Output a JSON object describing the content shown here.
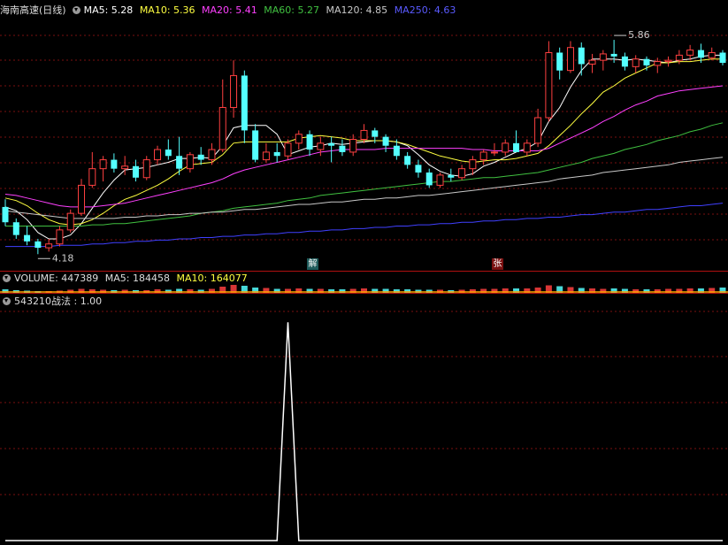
{
  "header_main": {
    "title": "海南高速(日线)",
    "ma5": "MA5: 5.28",
    "ma10": "MA10: 5.36",
    "ma20": "MA20: 5.41",
    "ma60": "MA60: 5.27",
    "ma120": "MA120: 4.85",
    "ma250": "MA250: 4.63"
  },
  "header_volume": {
    "volume": "VOLUME: 447389",
    "ma5": "MA5: 184458",
    "ma10": "MA10: 164077"
  },
  "header_indicator": {
    "label": "543210战法 : 1.00"
  },
  "markers": {
    "jie": "解",
    "zhang": "张"
  },
  "colors": {
    "up": "#ff4040",
    "down": "#54ffff",
    "ma5": "#ffffff",
    "ma10": "#ffff40",
    "ma20": "#ff40ff",
    "ma60": "#40c040",
    "ma120": "#c8c8c8",
    "ma250": "#4040ff",
    "grid": "#7a1010",
    "volume": "#ffa500"
  },
  "chart_data": [
    {
      "type": "candlestick",
      "title": "海南高速(日线)",
      "ylim": [
        4.05,
        6.02
      ],
      "annotations": [
        {
          "text": "4.18",
          "price": 4.18,
          "index": 3
        },
        {
          "text": "5.86",
          "price": 5.86,
          "index": 56
        }
      ],
      "candles": [
        [
          4.55,
          4.61,
          4.4,
          4.43
        ],
        [
          4.43,
          4.46,
          4.3,
          4.33
        ],
        [
          4.33,
          4.4,
          4.25,
          4.28
        ],
        [
          4.28,
          4.3,
          4.18,
          4.23
        ],
        [
          4.23,
          4.3,
          4.2,
          4.26
        ],
        [
          4.26,
          4.4,
          4.24,
          4.37
        ],
        [
          4.37,
          4.53,
          4.35,
          4.5
        ],
        [
          4.5,
          4.77,
          4.48,
          4.72
        ],
        [
          4.72,
          4.98,
          4.7,
          4.85
        ],
        [
          4.85,
          4.95,
          4.75,
          4.92
        ],
        [
          4.92,
          4.97,
          4.82,
          4.85
        ],
        [
          4.85,
          4.95,
          4.8,
          4.87
        ],
        [
          4.87,
          4.92,
          4.75,
          4.78
        ],
        [
          4.78,
          4.95,
          4.76,
          4.92
        ],
        [
          4.92,
          5.03,
          4.88,
          5.0
        ],
        [
          5.0,
          5.08,
          4.92,
          4.95
        ],
        [
          4.95,
          5.1,
          4.8,
          4.85
        ],
        [
          4.85,
          4.98,
          4.82,
          4.96
        ],
        [
          4.96,
          5.02,
          4.88,
          4.92
        ],
        [
          4.92,
          5.05,
          4.88,
          5.0
        ],
        [
          5.0,
          5.55,
          4.98,
          5.33
        ],
        [
          5.33,
          5.7,
          5.25,
          5.58
        ],
        [
          5.58,
          5.62,
          5.05,
          5.15
        ],
        [
          5.15,
          5.2,
          4.9,
          4.92
        ],
        [
          4.92,
          5.05,
          4.9,
          4.98
        ],
        [
          4.98,
          5.05,
          4.9,
          4.95
        ],
        [
          4.95,
          5.08,
          4.92,
          5.05
        ],
        [
          5.05,
          5.15,
          5.0,
          5.12
        ],
        [
          5.12,
          5.15,
          4.95,
          5.0
        ],
        [
          5.0,
          5.1,
          4.95,
          5.05
        ],
        [
          5.05,
          5.1,
          4.9,
          5.03
        ],
        [
          5.03,
          5.08,
          4.95,
          4.98
        ],
        [
          4.98,
          5.12,
          4.95,
          5.08
        ],
        [
          5.08,
          5.2,
          5.05,
          5.15
        ],
        [
          5.15,
          5.17,
          5.05,
          5.1
        ],
        [
          5.1,
          5.12,
          4.98,
          5.03
        ],
        [
          5.03,
          5.08,
          4.92,
          4.95
        ],
        [
          4.95,
          4.98,
          4.85,
          4.88
        ],
        [
          4.88,
          4.92,
          4.78,
          4.82
        ],
        [
          4.82,
          4.85,
          4.7,
          4.72
        ],
        [
          4.72,
          4.82,
          4.7,
          4.8
        ],
        [
          4.8,
          4.85,
          4.75,
          4.78
        ],
        [
          4.78,
          4.88,
          4.76,
          4.85
        ],
        [
          4.85,
          4.95,
          4.8,
          4.92
        ],
        [
          4.92,
          5.0,
          4.88,
          4.98
        ],
        [
          4.98,
          5.05,
          4.95,
          4.98
        ],
        [
          4.98,
          5.08,
          4.95,
          5.05
        ],
        [
          5.05,
          5.15,
          5.0,
          4.98
        ],
        [
          4.98,
          5.08,
          4.95,
          5.05
        ],
        [
          5.05,
          5.32,
          5.02,
          5.25
        ],
        [
          5.25,
          5.85,
          5.22,
          5.76
        ],
        [
          5.76,
          5.8,
          5.55,
          5.62
        ],
        [
          5.62,
          5.85,
          5.6,
          5.8
        ],
        [
          5.8,
          5.84,
          5.58,
          5.67
        ],
        [
          5.67,
          5.75,
          5.6,
          5.7
        ],
        [
          5.7,
          5.78,
          5.62,
          5.75
        ],
        [
          5.75,
          5.86,
          5.68,
          5.73
        ],
        [
          5.73,
          5.76,
          5.62,
          5.65
        ],
        [
          5.65,
          5.74,
          5.6,
          5.71
        ],
        [
          5.71,
          5.73,
          5.62,
          5.66
        ],
        [
          5.66,
          5.72,
          5.6,
          5.69
        ],
        [
          5.69,
          5.73,
          5.65,
          5.7
        ],
        [
          5.7,
          5.78,
          5.67,
          5.74
        ],
        [
          5.74,
          5.82,
          5.7,
          5.78
        ],
        [
          5.78,
          5.83,
          5.68,
          5.72
        ],
        [
          5.72,
          5.8,
          5.7,
          5.76
        ],
        [
          5.76,
          5.78,
          5.66,
          5.68
        ]
      ],
      "series": [
        {
          "name": "MA5",
          "values": [
            4.55,
            4.52,
            4.45,
            4.35,
            4.3,
            4.3,
            4.33,
            4.42,
            4.54,
            4.66,
            4.76,
            4.84,
            4.85,
            4.86,
            4.88,
            4.9,
            4.93,
            4.93,
            4.94,
            4.93,
            5.03,
            5.17,
            5.19,
            5.19,
            5.19,
            5.12,
            4.96,
            4.99,
            5.02,
            5.03,
            5.05,
            5.04,
            5.05,
            5.06,
            5.07,
            5.07,
            5.06,
            5.03,
            4.96,
            4.88,
            4.83,
            4.8,
            4.79,
            4.81,
            4.87,
            4.9,
            4.94,
            4.98,
            5.01,
            5.06,
            5.22,
            5.33,
            5.49,
            5.62,
            5.71,
            5.71,
            5.71,
            5.7,
            5.71,
            5.7,
            5.69,
            5.68,
            5.7,
            5.71,
            5.73,
            5.74,
            5.74
          ]
        },
        {
          "name": "MA10",
          "values": [
            4.62,
            4.6,
            4.56,
            4.5,
            4.45,
            4.42,
            4.41,
            4.42,
            4.45,
            4.5,
            4.56,
            4.61,
            4.64,
            4.68,
            4.72,
            4.77,
            4.83,
            4.88,
            4.89,
            4.9,
            4.96,
            5.05,
            5.06,
            5.06,
            5.06,
            5.06,
            5.06,
            5.09,
            5.1,
            5.11,
            5.1,
            5.09,
            5.07,
            5.07,
            5.07,
            5.07,
            5.06,
            5.04,
            5.01,
            4.98,
            4.95,
            4.93,
            4.91,
            4.9,
            4.91,
            4.92,
            4.92,
            4.93,
            4.95,
            4.97,
            5.03,
            5.11,
            5.19,
            5.28,
            5.36,
            5.45,
            5.5,
            5.56,
            5.6,
            5.64,
            5.68,
            5.68,
            5.69,
            5.69,
            5.7,
            5.71,
            5.71
          ]
        },
        {
          "name": "MA20",
          "values": [
            4.65,
            4.64,
            4.62,
            4.6,
            4.58,
            4.56,
            4.55,
            4.55,
            4.55,
            4.56,
            4.57,
            4.58,
            4.6,
            4.62,
            4.64,
            4.66,
            4.68,
            4.7,
            4.72,
            4.74,
            4.77,
            4.81,
            4.84,
            4.86,
            4.88,
            4.9,
            4.92,
            4.94,
            4.96,
            4.98,
            4.99,
            5.0,
            5.0,
            5.0,
            5.0,
            5.01,
            5.01,
            5.01,
            5.01,
            5.01,
            5.01,
            5.01,
            5.01,
            5.0,
            5.0,
            4.99,
            4.99,
            4.99,
            4.99,
            4.99,
            5.01,
            5.05,
            5.09,
            5.13,
            5.17,
            5.22,
            5.26,
            5.31,
            5.35,
            5.38,
            5.42,
            5.44,
            5.46,
            5.47,
            5.48,
            5.49,
            5.5
          ]
        },
        {
          "name": "MA60",
          "values": [
            4.4,
            4.4,
            4.4,
            4.4,
            4.4,
            4.4,
            4.4,
            4.4,
            4.41,
            4.41,
            4.42,
            4.42,
            4.43,
            4.44,
            4.45,
            4.46,
            4.47,
            4.48,
            4.5,
            4.51,
            4.52,
            4.54,
            4.55,
            4.56,
            4.57,
            4.58,
            4.6,
            4.61,
            4.62,
            4.64,
            4.65,
            4.66,
            4.67,
            4.68,
            4.69,
            4.7,
            4.71,
            4.72,
            4.73,
            4.74,
            4.75,
            4.75,
            4.76,
            4.77,
            4.78,
            4.78,
            4.79,
            4.8,
            4.81,
            4.82,
            4.84,
            4.86,
            4.88,
            4.9,
            4.93,
            4.95,
            4.97,
            5.0,
            5.02,
            5.04,
            5.07,
            5.09,
            5.11,
            5.14,
            5.16,
            5.19,
            5.21
          ]
        },
        {
          "name": "MA120",
          "values": [
            4.52,
            4.51,
            4.5,
            4.49,
            4.48,
            4.47,
            4.46,
            4.46,
            4.46,
            4.46,
            4.46,
            4.47,
            4.47,
            4.48,
            4.48,
            4.49,
            4.49,
            4.5,
            4.5,
            4.51,
            4.51,
            4.52,
            4.53,
            4.53,
            4.54,
            4.55,
            4.56,
            4.57,
            4.57,
            4.58,
            4.59,
            4.59,
            4.6,
            4.61,
            4.61,
            4.62,
            4.62,
            4.63,
            4.64,
            4.64,
            4.65,
            4.66,
            4.67,
            4.68,
            4.69,
            4.7,
            4.71,
            4.72,
            4.73,
            4.74,
            4.75,
            4.77,
            4.78,
            4.79,
            4.8,
            4.82,
            4.83,
            4.84,
            4.85,
            4.86,
            4.87,
            4.88,
            4.9,
            4.91,
            4.92,
            4.93,
            4.94
          ]
        },
        {
          "name": "MA250",
          "values": [
            4.24,
            4.24,
            4.24,
            4.24,
            4.24,
            4.25,
            4.25,
            4.25,
            4.26,
            4.26,
            4.27,
            4.27,
            4.28,
            4.28,
            4.29,
            4.29,
            4.3,
            4.3,
            4.31,
            4.31,
            4.32,
            4.32,
            4.33,
            4.33,
            4.34,
            4.34,
            4.35,
            4.35,
            4.36,
            4.36,
            4.37,
            4.37,
            4.38,
            4.38,
            4.39,
            4.39,
            4.4,
            4.4,
            4.41,
            4.41,
            4.42,
            4.42,
            4.43,
            4.43,
            4.44,
            4.44,
            4.45,
            4.45,
            4.46,
            4.46,
            4.47,
            4.47,
            4.48,
            4.49,
            4.49,
            4.5,
            4.51,
            4.51,
            4.52,
            4.53,
            4.53,
            4.54,
            4.55,
            4.56,
            4.56,
            4.57,
            4.58
          ]
        }
      ]
    },
    {
      "type": "bar",
      "title": "VOLUME",
      "values": [
        8,
        6,
        5,
        4,
        4,
        5,
        7,
        9,
        8,
        7,
        6,
        7,
        6,
        6,
        8,
        7,
        9,
        8,
        7,
        9,
        14,
        18,
        16,
        12,
        11,
        9,
        9,
        10,
        9,
        9,
        8,
        8,
        9,
        10,
        9,
        9,
        8,
        8,
        7,
        7,
        7,
        6,
        7,
        8,
        9,
        9,
        10,
        10,
        10,
        12,
        17,
        15,
        13,
        11,
        10,
        9,
        10,
        9,
        8,
        8,
        8,
        9,
        9,
        10,
        10,
        11,
        12
      ]
    },
    {
      "type": "line",
      "title": "543210战法",
      "ylim": [
        0,
        1.05
      ],
      "values": [
        0,
        0,
        0,
        0,
        0,
        0,
        0,
        0,
        0,
        0,
        0,
        0,
        0,
        0,
        0,
        0,
        0,
        0,
        0,
        0,
        0,
        0,
        0,
        0,
        0,
        0,
        1,
        0,
        0,
        0,
        0,
        0,
        0,
        0,
        0,
        0,
        0,
        0,
        0,
        0,
        0,
        0,
        0,
        0,
        0,
        0,
        0,
        0,
        0,
        0,
        0,
        0,
        0,
        0,
        0,
        0,
        0,
        0,
        0,
        0,
        0,
        0,
        0,
        0,
        0,
        0,
        0
      ]
    }
  ]
}
